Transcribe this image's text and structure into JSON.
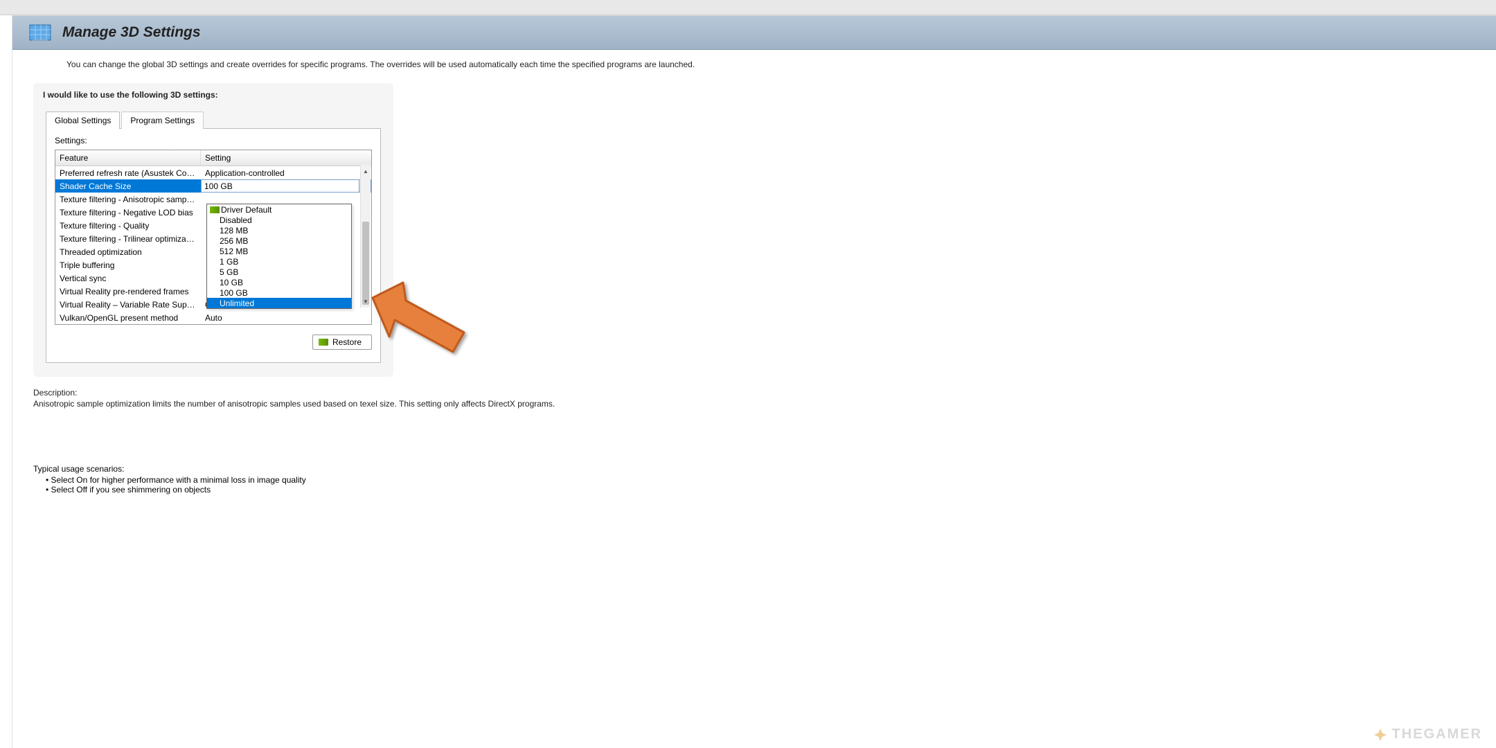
{
  "header": {
    "title": "Manage 3D Settings"
  },
  "intro": "You can change the global 3D settings and create overrides for specific programs. The overrides will be used automatically each time the specified programs are launched.",
  "section_label": "I would like to use the following 3D settings:",
  "tabs": {
    "global": "Global Settings",
    "program": "Program Settings"
  },
  "table": {
    "label": "Settings:",
    "col_feature": "Feature",
    "col_setting": "Setting",
    "rows": [
      {
        "feature": "Preferred refresh rate (Asustek Computer...",
        "setting": "Application-controlled"
      },
      {
        "feature": "Shader Cache Size",
        "setting": "100 GB"
      },
      {
        "feature": "Texture filtering - Anisotropic sample opti...",
        "setting": ""
      },
      {
        "feature": "Texture filtering - Negative LOD bias",
        "setting": ""
      },
      {
        "feature": "Texture filtering - Quality",
        "setting": ""
      },
      {
        "feature": "Texture filtering - Trilinear optimization",
        "setting": ""
      },
      {
        "feature": "Threaded optimization",
        "setting": ""
      },
      {
        "feature": "Triple buffering",
        "setting": ""
      },
      {
        "feature": "Vertical sync",
        "setting": ""
      },
      {
        "feature": "Virtual Reality pre-rendered frames",
        "setting": ""
      },
      {
        "feature": "Virtual Reality – Variable Rate Super Samp...",
        "setting": "Off"
      },
      {
        "feature": "Vulkan/OpenGL present method",
        "setting": "Auto"
      }
    ]
  },
  "dropdown": {
    "default": "Driver Default",
    "options": [
      "Disabled",
      "128 MB",
      "256 MB",
      "512 MB",
      "1 GB",
      "5 GB",
      "10 GB",
      "100 GB",
      "Unlimited"
    ],
    "highlighted": "Unlimited"
  },
  "restore_label": "Restore",
  "description": {
    "heading": "Description:",
    "text": "Anisotropic sample optimization limits the number of anisotropic samples used based on texel size. This setting only affects DirectX programs."
  },
  "usage": {
    "heading": "Typical usage scenarios:",
    "items": [
      "Select On for higher performance with a minimal loss in image quality",
      "Select Off if you see shimmering on objects"
    ]
  },
  "watermark": "THEGAMER"
}
